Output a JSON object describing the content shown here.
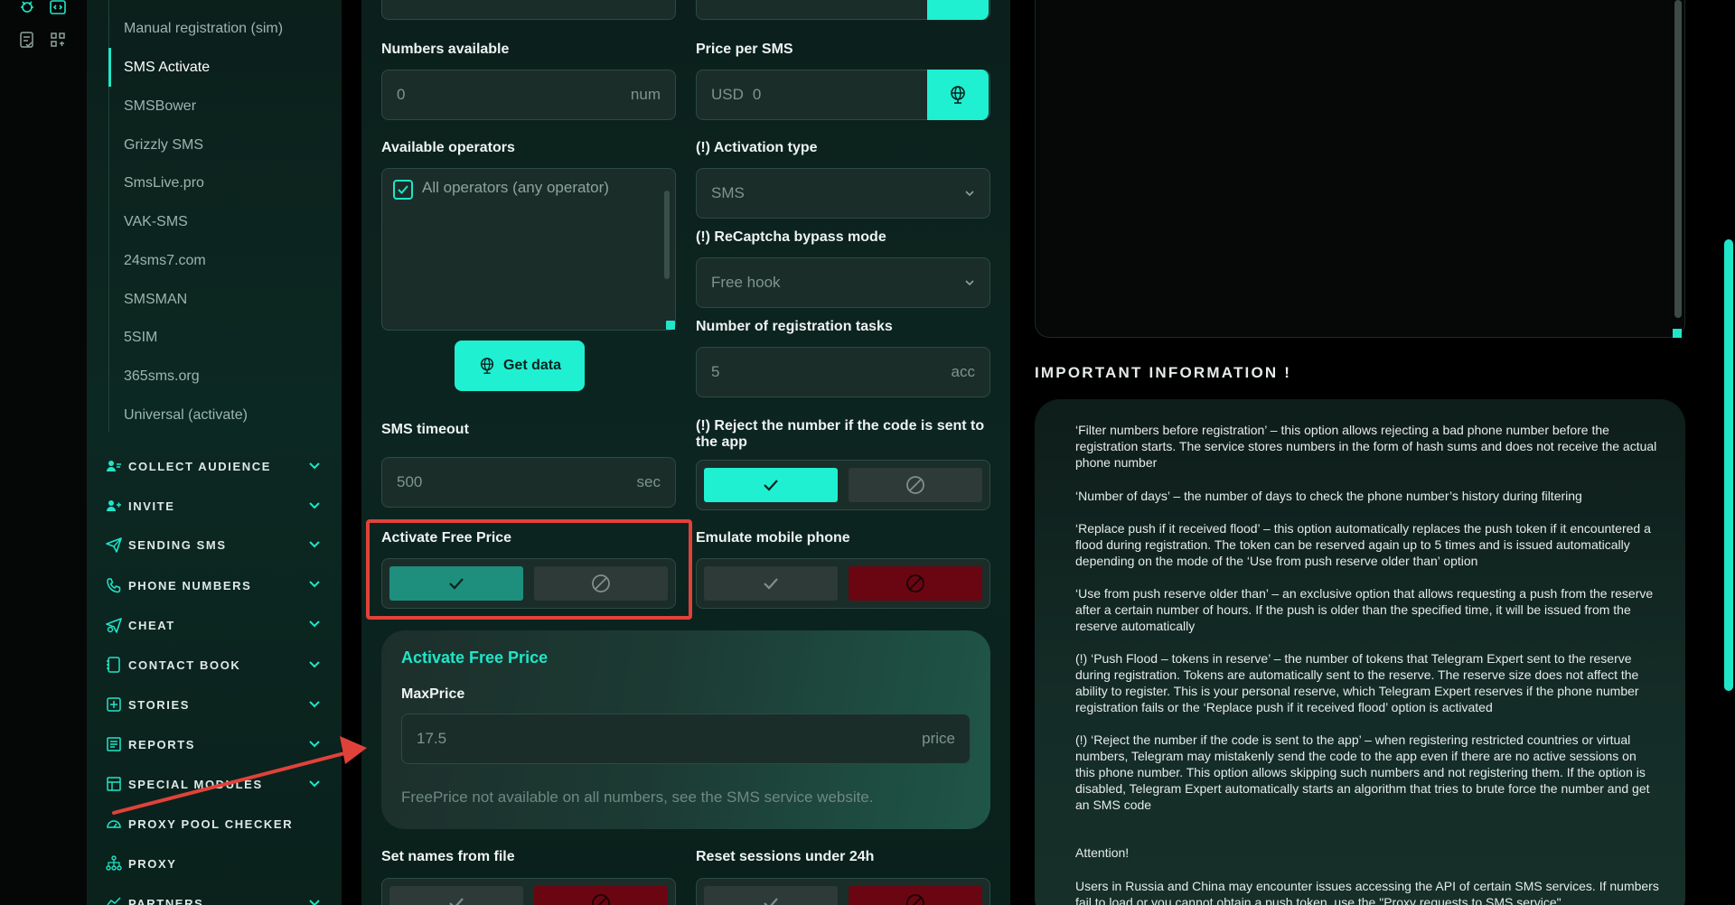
{
  "sidebar": {
    "sub_items": [
      {
        "label": "Manual registration (sim)",
        "active": false
      },
      {
        "label": "SMS Activate",
        "active": true
      },
      {
        "label": "SMSBower",
        "active": false
      },
      {
        "label": "Grizzly SMS",
        "active": false
      },
      {
        "label": "SmsLive.pro",
        "active": false
      },
      {
        "label": "VAK-SMS",
        "active": false
      },
      {
        "label": "24sms7.com",
        "active": false
      },
      {
        "label": "SMSMAN",
        "active": false
      },
      {
        "label": "5SIM",
        "active": false
      },
      {
        "label": "365sms.org",
        "active": false
      },
      {
        "label": "Universal (activate)",
        "active": false
      }
    ],
    "sections": [
      {
        "label": "COLLECT AUDIENCE",
        "icon": "users-icon",
        "has_chevron": true
      },
      {
        "label": "INVITE",
        "icon": "user-plus-icon",
        "has_chevron": true
      },
      {
        "label": "SENDING SMS",
        "icon": "send-icon",
        "has_chevron": true
      },
      {
        "label": "PHONE NUMBERS",
        "icon": "phone-icon",
        "has_chevron": true
      },
      {
        "label": "CHEAT",
        "icon": "cheat-send-icon",
        "has_chevron": true
      },
      {
        "label": "CONTACT BOOK",
        "icon": "contact-book-icon",
        "has_chevron": true
      },
      {
        "label": "STORIES",
        "icon": "stories-icon",
        "has_chevron": true
      },
      {
        "label": "REPORTS",
        "icon": "reports-icon",
        "has_chevron": true
      },
      {
        "label": "SPECIAL MODULES",
        "icon": "modules-icon",
        "has_chevron": true
      },
      {
        "label": "PROXY POOL CHECKER",
        "icon": "gauge-icon",
        "has_chevron": false
      },
      {
        "label": "PROXY",
        "icon": "network-icon",
        "has_chevron": false
      },
      {
        "label": "PARTNERS",
        "icon": "partners-icon",
        "has_chevron": true
      }
    ]
  },
  "form": {
    "numbers_available": {
      "label": "Numbers available",
      "value": "0",
      "unit": "num"
    },
    "price_per_sms": {
      "label": "Price per SMS",
      "currency": "USD",
      "value": "0"
    },
    "available_operators": {
      "label": "Available operators",
      "option": "All operators (any operator)",
      "checked": true
    },
    "activation_type": {
      "label": "(!) Activation type",
      "value": "SMS"
    },
    "recaptcha_mode": {
      "label": "(!) ReCaptcha bypass mode",
      "value": "Free hook"
    },
    "registration_tasks": {
      "label": "Number of registration tasks",
      "value": "5",
      "unit": "acc"
    },
    "get_data_button": "Get data",
    "sms_timeout": {
      "label": "SMS timeout",
      "value": "500",
      "unit": "sec"
    },
    "reject_number": {
      "label": "(!) Reject the number if the code is sent to the app",
      "state": "on"
    },
    "activate_free_price": {
      "label": "Activate Free Price",
      "state": "on"
    },
    "emulate_mobile": {
      "label": "Emulate mobile phone",
      "state": "off"
    },
    "free_price_card": {
      "title": "Activate Free Price",
      "max_price_label": "MaxPrice",
      "max_price_value": "17.5",
      "max_price_unit": "price",
      "note": "FreePrice not available on all numbers, see the SMS service website."
    },
    "set_names_from_file": {
      "label": "Set names from file",
      "state": "off"
    },
    "reset_sessions": {
      "label": "Reset sessions under 24h",
      "state": "off"
    }
  },
  "info": {
    "heading": "IMPORTANT INFORMATION !",
    "paragraphs": [
      "‘Filter numbers before registration’ – this option allows rejecting a bad phone number before the registration starts. The service stores numbers in the form of hash sums and does not receive the actual phone number",
      "‘Number of days’ – the number of days to check the phone number’s history during filtering",
      "‘Replace push if it received flood’ – this option automatically replaces the push token if it encountered a flood during registration. The token can be reserved again up to 5 times and is issued automatically depending on the mode of the ‘Use from push reserve older than’ option",
      "‘Use from push reserve older than’ – an exclusive option that allows requesting a push from the reserve after a certain number of hours. If the push is older than the specified time, it will be issued from the reserve automatically",
      "(!) ‘Push Flood – tokens in reserve’ – the number of tokens that Telegram Expert sent to the reserve during registration. Tokens are automatically sent to the reserve. The reserve size does not affect the ability to register. This is your personal reserve, which Telegram Expert reserves if the phone number registration fails or the ‘Replace push if it received flood’ option is activated",
      "(!) ‘Reject the number if the code is sent to the app’ – when registering restricted countries or virtual numbers, Telegram may mistakenly send the code to the app even if there are no active sessions on this phone number. This option allows skipping such numbers and not registering them. If the option is disabled, Telegram Expert automatically starts an algorithm that tries to brute force the number and get an SMS code",
      "Attention!",
      "Users in Russia and China may encounter issues accessing the API of certain SMS services. If numbers fail to load or you cannot obtain a push token, use the \"Proxy requests to SMS service\""
    ]
  },
  "colors": {
    "accent": "#1ff0d2",
    "toggle_on_dark": "#1d8f7c",
    "toggle_off_red": "#6a0612",
    "highlight_red": "#e0423a"
  }
}
